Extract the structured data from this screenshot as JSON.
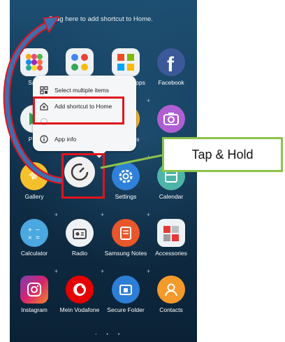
{
  "screen": {
    "drag_hint": "Drag here to add shortcut to Home.",
    "page_indicator": "◦ • •"
  },
  "apps": [
    {
      "label": "Sam",
      "icon": "samsung-folder-icon"
    },
    {
      "label": "",
      "icon": "google-folder-icon"
    },
    {
      "label": "Microsoft Apps",
      "icon": "microsoft-folder-icon"
    },
    {
      "label": "Facebook",
      "icon": "facebook-icon"
    },
    {
      "label": "Play",
      "icon": "play-store-icon"
    },
    {
      "label": "Messages",
      "icon": "messages-icon"
    },
    {
      "label": "",
      "icon": "camera-icon"
    },
    {
      "label": "Gallery",
      "icon": "gallery-icon"
    },
    {
      "label": "",
      "icon": "app-icon"
    },
    {
      "label": "Settings",
      "icon": "settings-icon"
    },
    {
      "label": "Calendar",
      "icon": "calendar-icon"
    },
    {
      "label": "Calculator",
      "icon": "calculator-icon"
    },
    {
      "label": "Radio",
      "icon": "radio-icon"
    },
    {
      "label": "Samsung Notes",
      "icon": "notes-icon"
    },
    {
      "label": "Accessories",
      "icon": "accessories-icon"
    },
    {
      "label": "Instagram",
      "icon": "instagram-icon"
    },
    {
      "label": "Mein Vodafone",
      "icon": "vodafone-icon"
    },
    {
      "label": "Secure Folder",
      "icon": "secure-folder-icon"
    },
    {
      "label": "Contacts",
      "icon": "contacts-icon"
    }
  ],
  "popup_menu": {
    "items": [
      {
        "label": "Select multiple items",
        "icon": "select-multiple-icon"
      },
      {
        "label": "Add shortcut to Home",
        "icon": "add-home-icon"
      },
      {
        "label": "",
        "icon": "hidden-item-icon"
      },
      {
        "label": "App info",
        "icon": "info-icon"
      }
    ]
  },
  "callout": {
    "text": "Tap & Hold"
  },
  "colors": {
    "highlight_red": "#e0141e",
    "callout_green": "#8bc34a",
    "arrow_blue": "#3d6fb0",
    "arrow_red": "#e0141e"
  }
}
